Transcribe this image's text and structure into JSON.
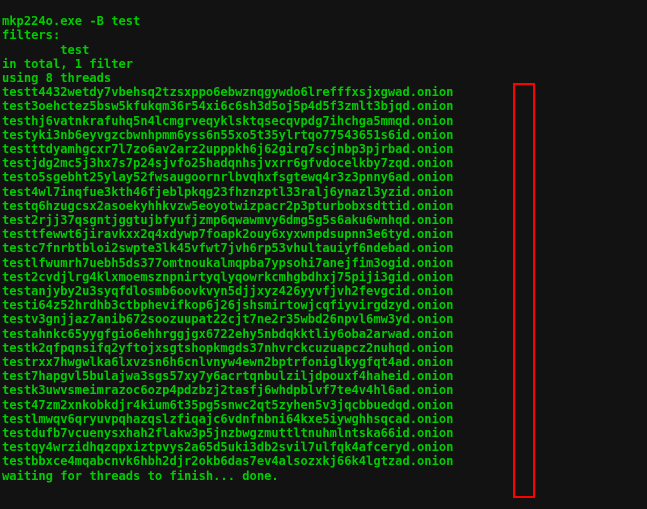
{
  "terminal": {
    "command": "mkp224o.exe -B test",
    "filters_header": "filters:",
    "filter_item": "        test",
    "total": "in total, 1 filter",
    "threads": "using 8 threads",
    "onions": [
      "testt4432wetdy7vbehsq2tzsxppo6ebwznqgywdo6lrefffxsjxgwad.onion",
      "test3oehctez5bsw5kfukqm36r54xi6c6sh3d5oj5p4d5f3zmlt3bjqd.onion",
      "testhj6vatnkrafuhq5n4lcmgrveqyklsktqsecqvpdg7ihchga5mmqd.onion",
      "testyki3nb6eyvgzcbwnhpmm6yss6n55xo5t35ylrtqo77543651s6id.onion",
      "testttdyamhgcxr7l7zo6av2arz2upppkh6j62girq7scjnbp3pjrbad.onion",
      "testjdg2mc5j3hx7s7p24sjvfo25hadqnhsjvxrr6gfvdocelkby7zqd.onion",
      "testo5sgebht25ylay52fwsaugoornrlbvqhxfsgtewq4r3z3pnny6ad.onion",
      "test4wl7inqfue3kth46fjeblpkqg23fhznzptl33ralj6ynazl3yzid.onion",
      "testq6hzugcsx2asoekyhhkvzw5eoyotwizpacr2p3pturbobxsdttid.onion",
      "test2rjj37qsgntjggtujbfyufjzmp6qwawmvy6dmg5g5s6aku6wnhqd.onion",
      "testtfewwt6jiravkxx2q4xdywp7foapk2ouy6xyxwnpdsupnn3e6tyd.onion",
      "testc7fnrbtbloi2swpte3lk45vfwt7jvh6rp53vhultauiyf6ndebad.onion",
      "testlfwumrh7uebh5ds377omtnoukalmqpba7ypsohi7anejfim3ogid.onion",
      "test2cvdjlrg4klxmoemsznpnirtyqlyqowrkcmhgbdhxj75piji3gid.onion",
      "testanjyby2u3syqfdlosmb6oovkvyn5djjxyz426yyvfjvh2fevgcid.onion",
      "testi64z52hrdhb3ctbphevifkop6j26jshsmirtowjcqfiyvirgdzyd.onion",
      "testv3gnjjaz7anib672soozuupat22cjt7ne2r35wbd26npvl6mw3yd.onion",
      "testahnkc65yygfgio6ehhrggjgx6722ehy5nbdqkktliy6oba2arwad.onion",
      "testk2qfpqnsifq2yftojxsgtshopkmgds37nhvrckcuzuapcz2nuhqd.onion",
      "testrxx7hwgwlka6lxvzsn6h6cnlvnyw4ewn2bptrfoniglkygfqt4ad.onion",
      "test7hapgvl5bulajwa3sgs57xy7y6acrtqnbulziljdpouxf4haheid.onion",
      "testk3uwvsmeimrazoc6ozp4pdzbzj2tasfj6whdpblvf7te4v4hl6ad.onion",
      "test47zm2xnkobkdjr4kium6t35pg5snwc2qt5zyhen5v3jqcbbuedqd.onion",
      "testlmwqv6qryuvpqhazqslzfiqajc6vdnfnbni64kxe5iywghhsqcad.onion",
      "testdufb7vcuenysxhah2flakw3p5jnzbwgzmuttltnuhmlntska66id.onion",
      "testqy4wrzidhqzqpxiztpvys2a65d5uki3db2svil7ulfqk4afceryd.onion",
      "testbbxce4mqabcnvk6hbh2djr2okb6das7ev4alsozxkj66k4lgtzad.onion"
    ],
    "waiting": "waiting for threads to finish... done."
  }
}
